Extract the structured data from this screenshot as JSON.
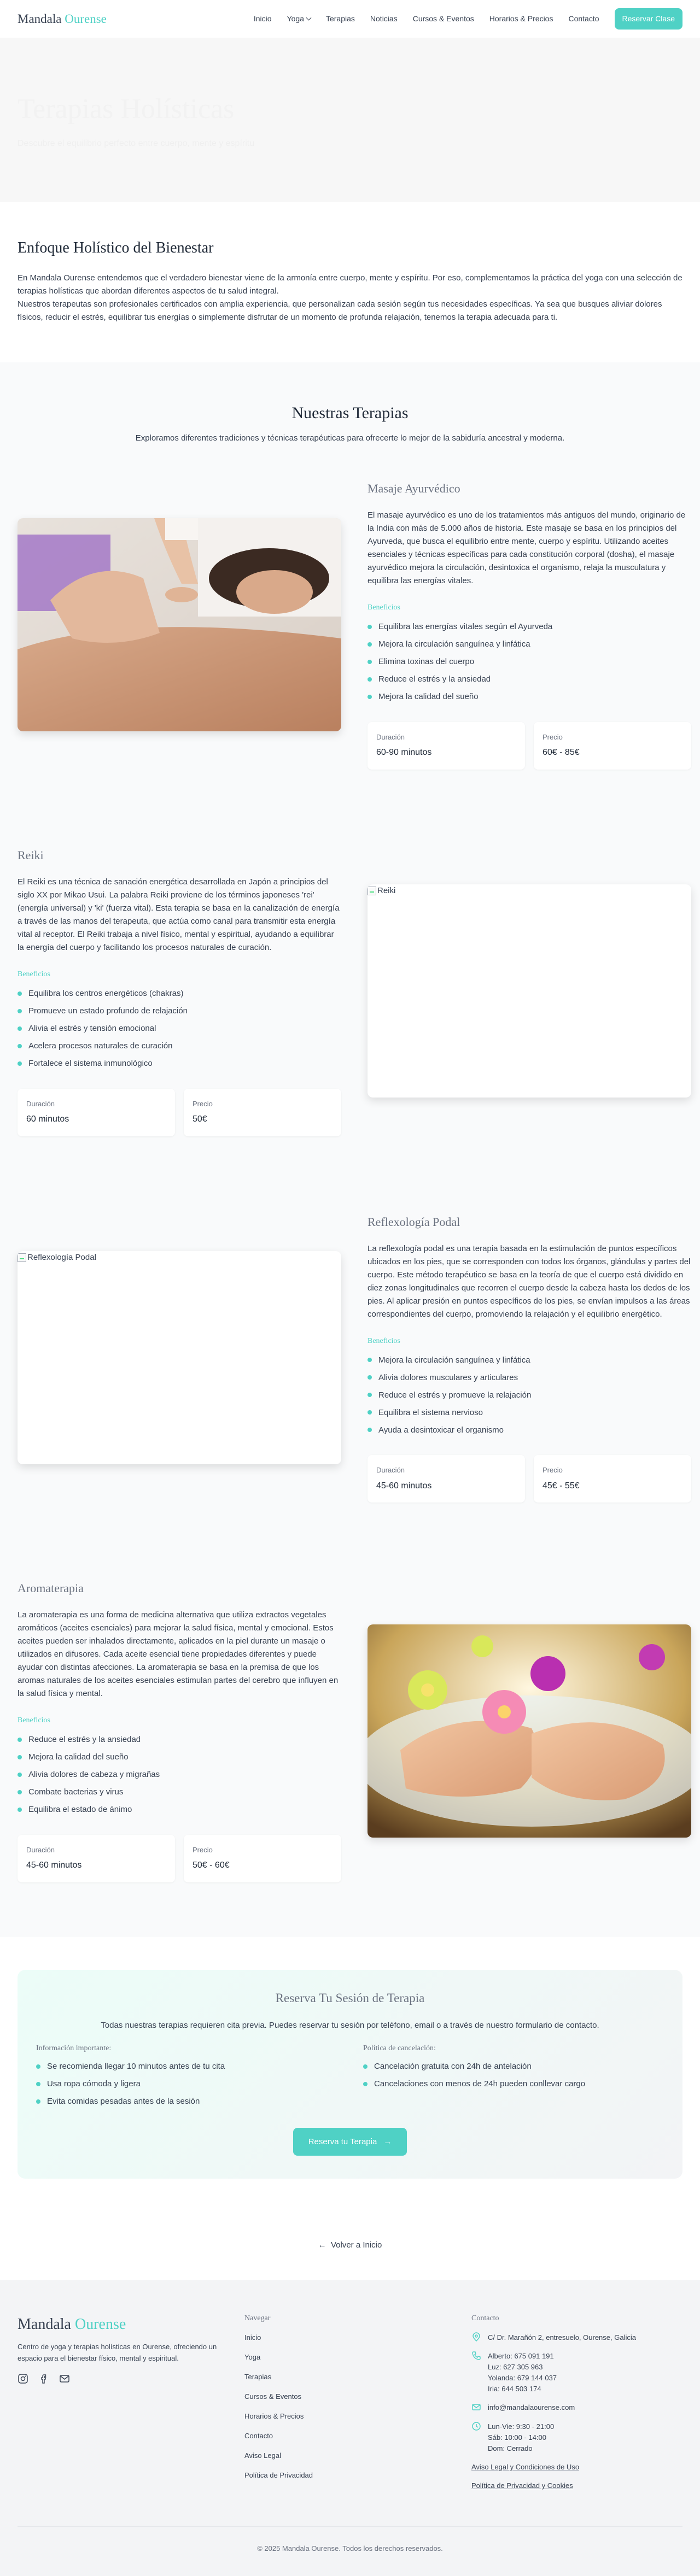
{
  "nav": {
    "logo_main": "Mandala",
    "logo_accent": "Ourense",
    "items": [
      "Inicio",
      "Yoga",
      "Terapias",
      "Noticias",
      "Cursos & Eventos",
      "Horarios & Precios",
      "Contacto"
    ],
    "cta": "Reservar Clase"
  },
  "hero": {
    "title": "Terapias Holísticas",
    "subtitle": "Descubre el equilibrio perfecto entre cuerpo, mente y espíritu"
  },
  "enfoque": {
    "title": "Enfoque Holístico del Bienestar",
    "p1": "En Mandala Ourense entendemos que el verdadero bienestar viene de la armonía entre cuerpo, mente y espíritu. Por eso, complementamos la práctica del yoga con una selección de terapias holísticas que abordan diferentes aspectos de tu salud integral.",
    "p2": "Nuestros terapeutas son profesionales certificados con amplia experiencia, que personalizan cada sesión según tus necesidades específicas. Ya sea que busques aliviar dolores físicos, reducir el estrés, equilibrar tus energías o simplemente disfrutar de un momento de profunda relajación, tenemos la terapia adecuada para ti."
  },
  "therapies": {
    "title": "Nuestras Terapias",
    "subtitle": "Exploramos diferentes tradiciones y técnicas terapéuticas para ofrecerte lo mejor de la sabiduría ancestral y moderna.",
    "benefits_label": "Beneficios",
    "duration_label": "Duración",
    "price_label": "Precio",
    "items": [
      {
        "name": "Masaje Ayurvédico",
        "description": "El masaje ayurvédico es uno de los tratamientos más antiguos del mundo, originario de la India con más de 5.000 años de historia. Este masaje se basa en los principios del Ayurveda, que busca el equilibrio entre mente, cuerpo y espíritu. Utilizando aceites esenciales y técnicas específicas para cada constitución corporal (dosha), el masaje ayurvédico mejora la circulación, desintoxica el organismo, relaja la musculatura y equilibra las energías vitales.",
        "benefits": [
          "Equilibra las energías vitales según el Ayurveda",
          "Mejora la circulación sanguínea y linfática",
          "Elimina toxinas del cuerpo",
          "Reduce el estrés y la ansiedad",
          "Mejora la calidad del sueño"
        ],
        "duration": "60-90 minutos",
        "price": "60€ - 85€",
        "image_alt": "Masaje Ayurvédico"
      },
      {
        "name": "Reiki",
        "description": "El Reiki es una técnica de sanación energética desarrollada en Japón a principios del siglo XX por Mikao Usui. La palabra Reiki proviene de los términos japoneses 'rei' (energía universal) y 'ki' (fuerza vital). Esta terapia se basa en la canalización de energía a través de las manos del terapeuta, que actúa como canal para transmitir esta energía vital al receptor. El Reiki trabaja a nivel físico, mental y espiritual, ayudando a equilibrar la energía del cuerpo y facilitando los procesos naturales de curación.",
        "benefits": [
          "Equilibra los centros energéticos (chakras)",
          "Promueve un estado profundo de relajación",
          "Alivia el estrés y tensión emocional",
          "Acelera procesos naturales de curación",
          "Fortalece el sistema inmunológico"
        ],
        "duration": "60 minutos",
        "price": "50€",
        "image_alt": "Reiki"
      },
      {
        "name": "Reflexología Podal",
        "description": "La reflexología podal es una terapia basada en la estimulación de puntos específicos ubicados en los pies, que se corresponden con todos los órganos, glándulas y partes del cuerpo. Este método terapéutico se basa en la teoría de que el cuerpo está dividido en diez zonas longitudinales que recorren el cuerpo desde la cabeza hasta los dedos de los pies. Al aplicar presión en puntos específicos de los pies, se envían impulsos a las áreas correspondientes del cuerpo, promoviendo la relajación y el equilibrio energético.",
        "benefits": [
          "Mejora la circulación sanguínea y linfática",
          "Alivia dolores musculares y articulares",
          "Reduce el estrés y promueve la relajación",
          "Equilibra el sistema nervioso",
          "Ayuda a desintoxicar el organismo"
        ],
        "duration": "45-60 minutos",
        "price": "45€ - 55€",
        "image_alt": "Reflexología Podal"
      },
      {
        "name": "Aromaterapia",
        "description": "La aromaterapia es una forma de medicina alternativa que utiliza extractos vegetales aromáticos (aceites esenciales) para mejorar la salud física, mental y emocional. Estos aceites pueden ser inhalados directamente, aplicados en la piel durante un masaje o utilizados en difusores. Cada aceite esencial tiene propiedades diferentes y puede ayudar con distintas afecciones. La aromaterapia se basa en la premisa de que los aromas naturales de los aceites esenciales estimulan partes del cerebro que influyen en la salud física y mental.",
        "benefits": [
          "Reduce el estrés y la ansiedad",
          "Mejora la calidad del sueño",
          "Alivia dolores de cabeza y migrañas",
          "Combate bacterias y virus",
          "Equilibra el estado de ánimo"
        ],
        "duration": "45-60 minutos",
        "price": "50€ - 60€",
        "image_alt": "Aromaterapia"
      }
    ]
  },
  "reserva": {
    "title": "Reserva Tu Sesión de Terapia",
    "subtitle": "Todas nuestras terapias requieren cita previa. Puedes reservar tu sesión por teléfono, email o a través de nuestro formulario de contacto.",
    "info_title": "Información importante:",
    "info_items": [
      "Se recomienda llegar 10 minutos antes de tu cita",
      "Usa ropa cómoda y ligera",
      "Evita comidas pesadas antes de la sesión"
    ],
    "cancel_title": "Política de cancelación:",
    "cancel_items": [
      "Cancelación gratuita con 24h de antelación",
      "Cancelaciones con menos de 24h pueden conllevar cargo"
    ],
    "button": "Reserva tu Terapia"
  },
  "back": "Volver a Inicio",
  "footer": {
    "logo_main": "Mandala",
    "logo_accent": "Ourense",
    "description": "Centro de yoga y terapias holísticas en Ourense, ofreciendo un espacio para el bienestar físico, mental y espiritual.",
    "nav_title": "Navegar",
    "nav_items": [
      "Inicio",
      "Yoga",
      "Terapias",
      "Cursos & Eventos",
      "Horarios & Precios",
      "Contacto",
      "Aviso Legal",
      "Política de Privacidad"
    ],
    "contact_title": "Contacto",
    "address": "C/ Dr. Marañón 2, entresuelo, Ourense, Galicia",
    "phones": [
      "Alberto: 675 091 191",
      "Luz: 627 305 963",
      "Yolanda: 679 144 037",
      "Iria: 644 503 174"
    ],
    "email": "info@mandalaourense.com",
    "hours": [
      "Lun-Vie: 9:30 - 21:00",
      "Sáb: 10:00 - 14:00",
      "Dom: Cerrado"
    ],
    "legal1": "Aviso Legal y Condiciones de Uso",
    "legal2": "Política de Privacidad y Cookies",
    "copyright": "© 2025 Mandala Ourense. Todos los derechos reservados."
  },
  "colors": {
    "accent": "#4fd1c5",
    "text": "#374151",
    "muted": "#6b7280"
  }
}
